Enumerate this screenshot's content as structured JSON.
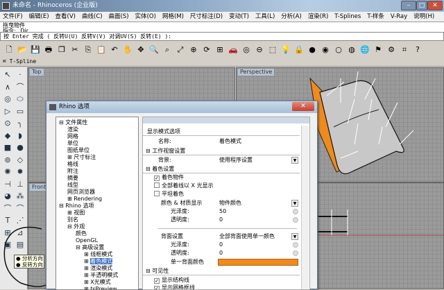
{
  "window": {
    "title": "未命名 - Rhinoceros (企业版)",
    "minimize": "–",
    "maximize": "□",
    "close": "✕"
  },
  "menu": [
    "文件(F)",
    "编辑(E)",
    "查看(V)",
    "曲线(C)",
    "曲面(S)",
    "实体(O)",
    "网格(M)",
    "尺寸标注(D)",
    "变动(T)",
    "工具(L)",
    "分析(A)",
    "渲染(R)",
    "T-Splines",
    "T-样条",
    "V-Ray",
    "说明(H)"
  ],
  "command": {
    "history": [
      "拖曳物件",
      "指令: _Dir"
    ],
    "prompt": "按 Enter 完成 ( 反转U(U)  反转V(V)  对调UV(S)  反转(E) ):"
  },
  "toolbar_icons": [
    {
      "name": "new-file",
      "g": "🗋"
    },
    {
      "name": "open-folder",
      "g": "📂"
    },
    {
      "name": "save",
      "g": "💾"
    },
    {
      "name": "print",
      "g": "🖶"
    },
    {
      "name": "copy-template",
      "g": "❐"
    },
    {
      "name": "cut",
      "g": "✂"
    },
    {
      "name": "copy",
      "g": "⎘"
    },
    {
      "name": "paste",
      "g": "📋"
    },
    {
      "name": "undo",
      "g": "↶"
    },
    {
      "name": "pan-hand",
      "g": "✋"
    },
    {
      "name": "move-view",
      "g": "✥"
    },
    {
      "name": "zoom",
      "g": "🔍"
    },
    {
      "name": "zoom-window",
      "g": "⌕"
    },
    {
      "name": "zoom-extents",
      "g": "⤢"
    },
    {
      "name": "zoom-selected",
      "g": "⊕"
    },
    {
      "name": "rotate-view",
      "g": "⟳"
    },
    {
      "name": "four-viewports",
      "g": "⊞"
    },
    {
      "name": "car-render",
      "g": "🚗"
    },
    {
      "name": "shaded-view",
      "g": "◎"
    },
    {
      "name": "select-points",
      "g": "⊖"
    },
    {
      "name": "layers",
      "g": "⬚"
    },
    {
      "name": "light-bulb",
      "g": "💡"
    },
    {
      "name": "lock",
      "g": "🔒"
    },
    {
      "name": "material",
      "g": "●"
    },
    {
      "name": "color-wheel",
      "g": "◉"
    },
    {
      "name": "render-sphere",
      "g": "○"
    },
    {
      "name": "render-settings",
      "g": "◍"
    },
    {
      "name": "globe",
      "g": "🌐"
    },
    {
      "name": "flag",
      "g": "⚑"
    },
    {
      "name": "gear",
      "g": "⚙"
    },
    {
      "name": "grid-snap",
      "g": "⌗"
    },
    {
      "name": "help",
      "g": "?"
    }
  ],
  "tspline_tab": "T-Spline",
  "left_toolbar": [
    "select-arrow",
    "point",
    "polyline",
    "control-curve",
    "circle",
    "ellipse",
    "arc",
    "rectangle",
    "circle-center",
    "fillet-curve",
    "surface",
    "surface-edge",
    "box",
    "sphere",
    "cylinder",
    "extrude",
    "explode",
    "boolean",
    "trim",
    "split",
    "cap",
    "group",
    "curve",
    "curve-edge",
    "text",
    "control-points",
    "transform",
    "mirror",
    "analyze-direction",
    "dir-toggle"
  ],
  "tooltip": [
    "分析方向",
    "反转方向"
  ],
  "viewports": {
    "top": "Top",
    "perspective": "Perspective",
    "front": "Front"
  },
  "dialog": {
    "title": "Rhino 选项",
    "close": "✕",
    "tree": [
      {
        "t": "文件属性",
        "l": 0,
        "e": "⊟"
      },
      {
        "t": "渲染",
        "l": 1
      },
      {
        "t": "网格",
        "l": 1
      },
      {
        "t": "单位",
        "l": 1
      },
      {
        "t": "图纸单位",
        "l": 1
      },
      {
        "t": "尺寸标注",
        "l": 1,
        "e": "⊞"
      },
      {
        "t": "格线",
        "l": 1
      },
      {
        "t": "附注",
        "l": 1
      },
      {
        "t": "摘要",
        "l": 1
      },
      {
        "t": "线型",
        "l": 1
      },
      {
        "t": "网页浏览器",
        "l": 1
      },
      {
        "t": "Rendering",
        "l": 1,
        "e": "⊞"
      },
      {
        "t": "Rhino 选项",
        "l": 0,
        "e": "⊟"
      },
      {
        "t": "视图",
        "l": 1,
        "e": "⊞"
      },
      {
        "t": "别名",
        "l": 1
      },
      {
        "t": "外观",
        "l": 1,
        "e": "⊟"
      },
      {
        "t": "颜色",
        "l": 2
      },
      {
        "t": "OpenGL",
        "l": 2
      },
      {
        "t": "高级设置",
        "l": 2,
        "e": "⊟"
      },
      {
        "t": "线框模式",
        "l": 3,
        "e": "⊞"
      },
      {
        "t": "着色模式",
        "l": 3,
        "e": "⊞",
        "sel": true
      },
      {
        "t": "渲染模式",
        "l": 3,
        "e": "⊞"
      },
      {
        "t": "半透明模式",
        "l": 3,
        "e": "⊞"
      },
      {
        "t": "X光模式",
        "l": 3,
        "e": "⊞"
      },
      {
        "t": "tsPreview",
        "l": 3,
        "e": "⊞"
      }
    ],
    "panel": {
      "section_title": "显示模式选项",
      "name_label": "名称:",
      "name_value": "着色模式",
      "viewport_section": "工作视窗设置",
      "bg_label": "背景:",
      "bg_value": "使用程序设置",
      "shading_section": "着色设置",
      "shade_objects": "着色物件",
      "shade_objects_checked": true,
      "xray_all": "全部着线以 X 光显示",
      "xray_checked": false,
      "flat_shading": "平坦着色",
      "flat_checked": false,
      "color_material_label": "颜色 & 材质显示",
      "color_material_value": "物件颜色",
      "gloss_label": "光泽度:",
      "gloss_value": "50",
      "transparency_label": "透明度:",
      "transparency_value": "0",
      "backface_label": "背面设置",
      "backface_value": "全部背面使用单一颜色",
      "back_gloss_label": "光泽度:",
      "back_gloss_value": "0",
      "back_transparency_label": "透明度:",
      "back_transparency_value": "0",
      "single_back_color_label": "单一背面颜色",
      "single_back_color": "#f08a1c",
      "visibility_section": "可见性",
      "show_isocurves": "显示结构线",
      "show_isocurves_checked": true,
      "show_mesh_wires": "显示网格框线",
      "show_mesh_wires_checked": true
    }
  }
}
